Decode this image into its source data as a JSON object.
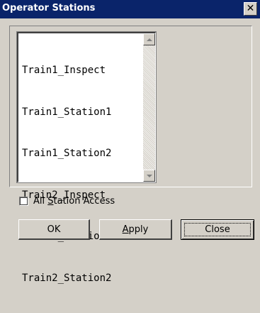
{
  "window": {
    "title": "Operator Stations",
    "close_glyph": "✕"
  },
  "stations_list": {
    "items": [
      "Train1_Inspect",
      "Train1_Station1",
      "Train1_Station2",
      "Train2_Inspect",
      "Train2_Station1",
      "Train2_Station2"
    ]
  },
  "all_access": {
    "label_pre": "All ",
    "label_key": "S",
    "label_post": "tation Access",
    "checked": false
  },
  "buttons": {
    "ok": "OK",
    "apply_key": "A",
    "apply_rest": "pply",
    "close": "Close"
  }
}
